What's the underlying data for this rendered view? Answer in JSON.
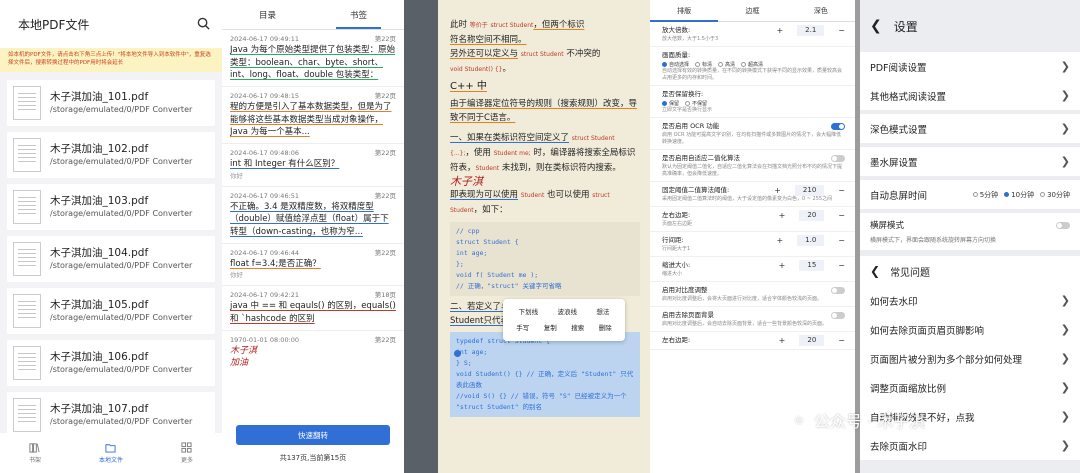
{
  "p1": {
    "title": "本地PDF文件",
    "warning": "如本机的PDF文件，请点击右下角三点上传！\"将本地文件导入到本软件中\"，重复选择文件后，搜索转换过程中的PDF用时将会延长",
    "files": [
      {
        "name": "木子淇加油_101.pdf",
        "path": "/storage/emulated/0/PDF Converter"
      },
      {
        "name": "木子淇加油_102.pdf",
        "path": "/storage/emulated/0/PDF Converter"
      },
      {
        "name": "木子淇加油_103.pdf",
        "path": "/storage/emulated/0/PDF Converter"
      },
      {
        "name": "木子淇加油_104.pdf",
        "path": "/storage/emulated/0/PDF Converter"
      },
      {
        "name": "木子淇加油_105.pdf",
        "path": "/storage/emulated/0/PDF Converter"
      },
      {
        "name": "木子淇加油_106.pdf",
        "path": "/storage/emulated/0/PDF Converter"
      },
      {
        "name": "木子淇加油_107.pdf",
        "path": "/storage/emulated/0/PDF Converter"
      }
    ],
    "nav": [
      "书架",
      "本地文件",
      "更多"
    ]
  },
  "p2": {
    "tabs": [
      "目录",
      "书签"
    ],
    "notes": [
      {
        "date": "2024-06-17 09:49:11",
        "page": "第22页",
        "text": "Java 为每个原始类型提供了包装类型：原始类型：boolean、char、byte、short、int、long、float、double 包装类型：Boolean、..."
      },
      {
        "date": "2024-06-17 09:48:15",
        "page": "第22页",
        "text": "程的方便是引入了基本数据类型，但是为了能够将这些基本数据类型当成对象操作，Java 为每一个基本..."
      },
      {
        "date": "2024-06-17 09:48:06",
        "page": "第22页",
        "text": "int 和 Integer 有什么区别？",
        "comment": "你好"
      },
      {
        "date": "2024-06-17 09:46:51",
        "page": "第22页",
        "text": "不正确。3.4 是双精度数，将双精度型（double）赋值给浮点型（float）属于下转型（down-casting，也称为窄..."
      },
      {
        "date": "2024-06-17 09:46:44",
        "page": "第22页",
        "text": "float f=3.4;是否正确？",
        "comment": "你好"
      },
      {
        "date": "2024-06-17 09:42:21",
        "page": "第18页",
        "text": "java 中 == 和 eqauls() 的区别，equals() 和 `hashcode 的区别"
      },
      {
        "date": "1970-01-01 08:00:00",
        "page": "第22页",
        "sig1": "木子淇",
        "sig2": "加油"
      }
    ],
    "button": "快速翻转",
    "footer": "共137页,当前第15页"
  },
  "p3": {
    "l1": "此时",
    "l1b": "等价于",
    "l1c": "struct Student",
    "l1d": "，但两个标识",
    "l2": "符名称空间不相同。",
    "l3": "另外还可以定义与",
    "l3b": "struct Student",
    "l3c": "不冲突的",
    "l4": "void Student() {}",
    "l4b": "。",
    "l5": "C++ 中",
    "l6": "由于编译器定位符号的规则（搜索规则）改变，导致不同于C语言。",
    "l7": "一、如果在类标识符空间定义了",
    "l7b": "struct Student {...};",
    "l7c": "，使用",
    "l7d": "Student me;",
    "l7e": "时，编译器将搜索全局标识符表，",
    "l7f": "Student",
    "l7g": "未找到，则在类标识符内搜索。",
    "sig": "木子淇",
    "l8": "即表现为可以使用",
    "l8b": "Student",
    "l8c": "也可以使用",
    "l8d": "struct Student",
    "l8e": "，如下：",
    "code1": [
      "// cpp",
      "struct Student {",
      "  int age;",
      "};",
      "void f( Student me );",
      "// 正确，\"struct\" 关键字可省略"
    ],
    "l9": "二、若定义了与Student 同名函数之后，则Student只代表函数，不代表结构体，如下：",
    "code2": [
      "typedef struct Student {",
      "  int age;",
      "} S;",
      "void Student() {}  // 正确，定义后 \"Student\" 只代表此函数",
      "//void S() {}  // 错误，符号 \"S\" 已经被定义为一个 \"struct Student\" 的别名"
    ],
    "popup1": [
      "下划线",
      "波浪线",
      "想法"
    ],
    "popup2": [
      "手写",
      "复制",
      "搜索",
      "删除"
    ]
  },
  "p4": {
    "tabs": [
      "排版",
      "边框",
      "深色"
    ],
    "items": [
      {
        "title": "放大倍数:",
        "desc": "放大倍数，大于1.5小于3",
        "val": "2.1"
      },
      {
        "title": "画面质量:",
        "desc": "自动选择有效的转换质量，在不同的转换模式下获得不同的显示效果，质量较高会占用更多的内存和时间。",
        "radio": [
          "自动选择",
          "标清",
          "高清",
          "超高清"
        ]
      },
      {
        "title": "是否保留换行:",
        "desc": "立即文字是否换行显示",
        "radio": [
          "保留",
          "不保留"
        ]
      },
      {
        "title": "是否启用 OCR 功能",
        "desc": "启用 OCR 功能可提高文字识别，在均有扫描件或多数图片的情况下，会大幅降低转换速度。",
        "toggle": true
      },
      {
        "title": "是否启用自适应二值化算法",
        "desc": "默认为固定阈值二值化，自适应二值化算法会在扫描文档光照分布不均的情况下提高准确率，但会降低速度。",
        "toggle": false
      },
      {
        "title": "固定阈值二值算法阈值:",
        "desc": "采用固定阈值二值算法时的阈值，大于设定值的像素变为白色，0 ~ 255之间",
        "val": "210"
      },
      {
        "title": "左右边距:",
        "desc": "页面左右边距",
        "val": "20"
      },
      {
        "title": "行间距:",
        "desc": "行间距大于1",
        "val": "1.0"
      },
      {
        "title": "缩进大小:",
        "desc": "缩进大小",
        "val": "15"
      },
      {
        "title": "启用对比度调整",
        "desc": "启用对比度调整后，会将大页面进行对比度，适合字体颜色较浅的页面。",
        "toggle": false
      },
      {
        "title": "启用去除页面背景",
        "desc": "启用对比度调整后，会自动去除页面背景，适合一些背景颜色较深的页面。",
        "toggle": false
      },
      {
        "title": "左右边距:",
        "desc": "",
        "val": "20"
      }
    ]
  },
  "p5": {
    "title": "设置",
    "rows": [
      "PDF阅读设置",
      "其他格式阅读设置",
      "深色模式设置",
      "墨水屏设置"
    ],
    "auto_label": "自动息屏时间",
    "auto_opts": [
      "5分钟",
      "10分钟",
      "30分钟"
    ],
    "landscape_title": "横屏模式",
    "landscape_desc": "横屏模式下，界面会跟随系统旋转屏幕方向切换",
    "faq_title": "常见问题",
    "faq": [
      "如何去水印",
      "如何去除页面页眉页脚影响",
      "页面图片被分割为多个部分如何处理",
      "调整页面缩放比例",
      "自动排版效果不好，点我",
      "去除页面水印"
    ]
  },
  "watermark": "公众号 · 木子淇"
}
